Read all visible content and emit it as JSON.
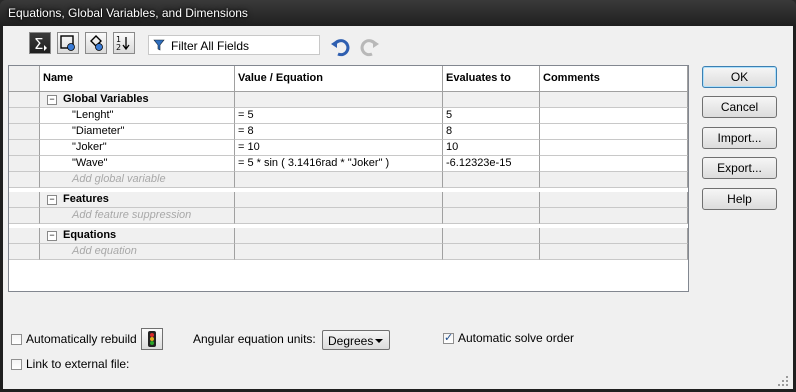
{
  "window": {
    "title": "Equations, Global Variables, and Dimensions"
  },
  "toolbar": {
    "buttons": [
      {
        "name": "equation-view-icon",
        "pressed": true
      },
      {
        "name": "sketch-equation-view-icon",
        "pressed": false
      },
      {
        "name": "dimension-view-icon",
        "pressed": false
      },
      {
        "name": "ordered-view-icon",
        "pressed": false
      }
    ],
    "filter_label": "Filter All Fields"
  },
  "grid": {
    "columns": [
      "Name",
      "Value / Equation",
      "Evaluates to",
      "Comments"
    ],
    "groups": [
      {
        "label": "Global Variables",
        "expander": "−",
        "rows": [
          {
            "name": "\"Lenght\"",
            "value": "= 5",
            "evaluates": "5",
            "comment": ""
          },
          {
            "name": "\"Diameter\"",
            "value": "= 8",
            "evaluates": "8",
            "comment": ""
          },
          {
            "name": "\"Joker\"",
            "value": "= 10",
            "evaluates": "10",
            "comment": ""
          },
          {
            "name": "\"Wave\"",
            "value": "= 5 * sin ( 3.1416rad * \"Joker\" )",
            "evaluates": "-6.12323e-15",
            "comment": ""
          }
        ],
        "add_placeholder": "Add global variable"
      },
      {
        "label": "Features",
        "expander": "−",
        "rows": [],
        "add_placeholder": "Add feature suppression"
      },
      {
        "label": "Equations",
        "expander": "−",
        "rows": [],
        "add_placeholder": "Add equation"
      }
    ]
  },
  "buttons": {
    "ok": "OK",
    "cancel": "Cancel",
    "import": "Import...",
    "export": "Export...",
    "help": "Help"
  },
  "options": {
    "auto_rebuild": {
      "label": "Automatically rebuild",
      "checked": false
    },
    "angular_units_label": "Angular equation units:",
    "angular_units_value": "Degrees",
    "auto_solve": {
      "label": "Automatic solve order",
      "checked": true
    },
    "link_external": {
      "label": "Link to external file:",
      "checked": false
    }
  }
}
